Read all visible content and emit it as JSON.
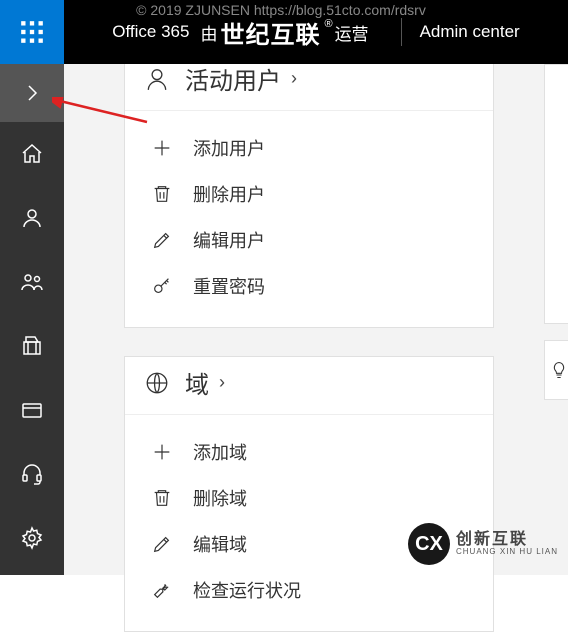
{
  "watermark": "© 2019 ZJUNSEN https://blog.51cto.com/rdsrv",
  "header": {
    "o365": "Office 365",
    "by": "由",
    "partner": "世纪互联",
    "operated": "运营",
    "admin_center": "Admin center"
  },
  "cards": {
    "users": {
      "title": "活动用户",
      "actions": {
        "add": "添加用户",
        "delete": "删除用户",
        "edit": "编辑用户",
        "reset": "重置密码"
      }
    },
    "domains": {
      "title": "域",
      "actions": {
        "add": "添加域",
        "delete": "删除域",
        "edit": "编辑域",
        "check": "检查运行状况"
      }
    }
  },
  "logo": {
    "line1": "创新互联",
    "line2": "CHUANG XIN HU LIAN"
  }
}
